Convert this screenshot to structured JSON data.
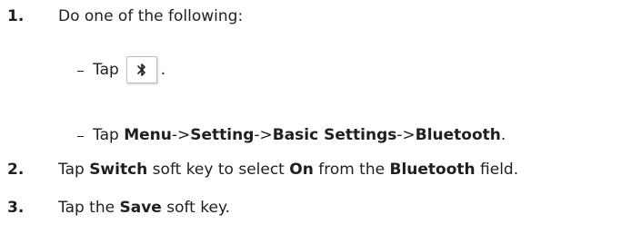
{
  "steps": [
    {
      "number": "1.",
      "text": "Do one of the following:"
    },
    {
      "number": "2.",
      "parts": [
        "Tap ",
        "Switch",
        " soft key to select ",
        "On",
        " from the ",
        "Bluetooth",
        " field."
      ]
    },
    {
      "number": "3.",
      "parts": [
        "Tap the ",
        "Save",
        " soft key."
      ]
    }
  ],
  "substeps": [
    {
      "before": "Tap",
      "icon": "bluetooth-icon",
      "after": "."
    },
    {
      "parts": [
        "Tap ",
        "Menu",
        "->",
        "Setting",
        "->",
        "Basic Settings",
        "->",
        "Bluetooth",
        "."
      ]
    }
  ]
}
